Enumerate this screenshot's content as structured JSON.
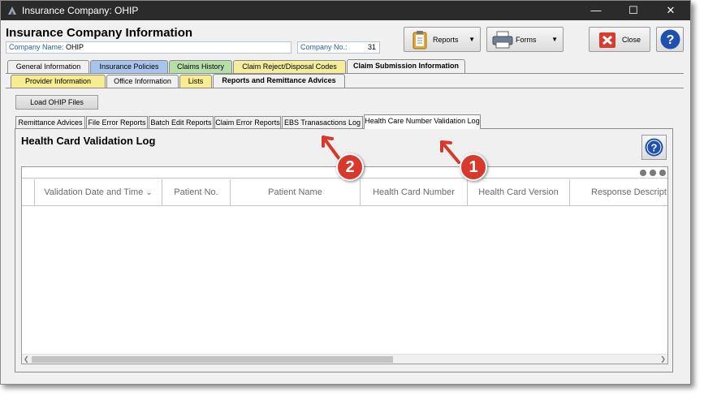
{
  "window": {
    "title": "Insurance Company:  OHIP"
  },
  "header": {
    "title": "Insurance Company Information",
    "company_name_label": "Company Name:",
    "company_name_value": "OHIP",
    "company_no_label": "Company No.:",
    "company_no_value": "31"
  },
  "toolbar": {
    "reports_label": "Reports",
    "forms_label": "Forms",
    "close_label": "Close"
  },
  "tabs_row1": [
    {
      "label": "General Information",
      "color": "#f0f0f0"
    },
    {
      "label": "Insurance Policies",
      "color": "#a9c4ec"
    },
    {
      "label": "Claims History",
      "color": "#b6dea8"
    },
    {
      "label": "Claim Reject/Disposal Codes",
      "color": "#f5ec9c"
    },
    {
      "label": "Claim Submission Information",
      "color": "#f0f0f0",
      "active": true
    }
  ],
  "tabs_row2": [
    {
      "label": "Provider Information",
      "color": "#f7ec8f"
    },
    {
      "label": "Office Information",
      "color": "#f0f0f0"
    },
    {
      "label": "Lists",
      "color": "#f7ec8f"
    },
    {
      "label": "Reports and Remittance Advices",
      "color": "#f0f0f0",
      "active": true
    }
  ],
  "load_button_label": "Load OHIP Files",
  "sub_tabs": [
    {
      "label": "Remittance Advices"
    },
    {
      "label": "File Error Reports"
    },
    {
      "label": "Batch Edit Reports"
    },
    {
      "label": "Claim Error Reports"
    },
    {
      "label": "EBS Tranasactions Log"
    },
    {
      "label": "Health Care Number Validation Log",
      "active": true
    }
  ],
  "panel": {
    "title": "Health Card Validation Log",
    "columns": [
      "Validation Date and Time",
      "Patient No.",
      "Patient Name",
      "Health Card Number",
      "Health Card Version",
      "Response Descript"
    ]
  },
  "callouts": [
    "1",
    "2"
  ],
  "colors": {
    "callout": "#d9382c",
    "help_blue": "#1f4fb0"
  }
}
